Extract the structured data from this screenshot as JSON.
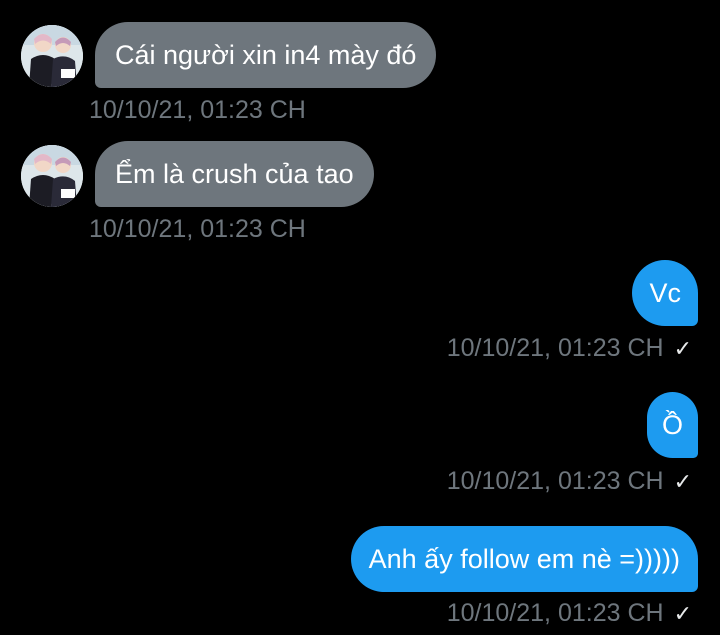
{
  "conversation": {
    "messages": [
      {
        "direction": "incoming",
        "text": "Cái người xin in4 mày đó",
        "timestamp": "10/10/21, 01:23 CH"
      },
      {
        "direction": "incoming",
        "text": "Ểm là crush của tao",
        "timestamp": "10/10/21, 01:23 CH"
      },
      {
        "direction": "outgoing",
        "text": "Vc",
        "timestamp": "10/10/21, 01:23 CH",
        "status": "✓"
      },
      {
        "direction": "outgoing",
        "text": "Ồ",
        "timestamp": "10/10/21, 01:23 CH",
        "status": "✓"
      },
      {
        "direction": "outgoing",
        "text": "Anh ấy follow em nè =)))))",
        "timestamp": "10/10/21, 01:23 CH",
        "status": "✓"
      }
    ]
  },
  "colors": {
    "background": "#000000",
    "incoming_bubble": "#6e767d",
    "outgoing_bubble": "#1d9bf0",
    "timestamp": "#6e767d"
  },
  "icons": {
    "avatar": "user-avatar-anime",
    "status": "check-icon"
  }
}
